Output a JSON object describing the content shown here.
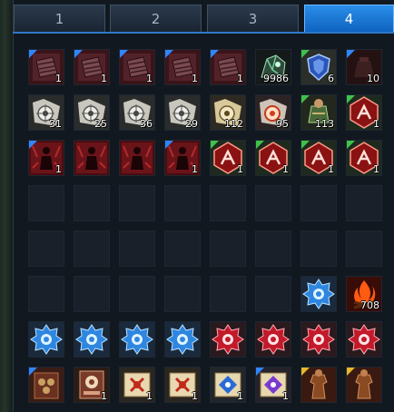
{
  "tabs": [
    {
      "label": "1",
      "active": false
    },
    {
      "label": "2",
      "active": false
    },
    {
      "label": "3",
      "active": false
    },
    {
      "label": "4",
      "active": true
    }
  ],
  "rows": [
    [
      {
        "icon": "dark-scroll-icon",
        "qty": "1",
        "tri": "#2f86ff"
      },
      {
        "icon": "dark-scroll-icon",
        "qty": "1",
        "tri": "#2f86ff"
      },
      {
        "icon": "dark-scroll-icon",
        "qty": "1",
        "tri": "#2f86ff"
      },
      {
        "icon": "dark-scroll-icon",
        "qty": "1",
        "tri": "#2f86ff"
      },
      {
        "icon": "dark-scroll-icon",
        "qty": "1",
        "tri": "#2f86ff"
      },
      {
        "icon": "green-ore-icon",
        "qty": "9986",
        "tri": ""
      },
      {
        "icon": "blue-shield-icon",
        "qty": "6",
        "tri": "#3fc24a"
      },
      {
        "icon": "dark-pouch-icon",
        "qty": "10",
        "tri": "#2f86ff"
      }
    ],
    [
      {
        "icon": "map-scroll-icon",
        "qty": "31",
        "tri": ""
      },
      {
        "icon": "map-scroll-icon",
        "qty": "25",
        "tri": ""
      },
      {
        "icon": "map-scroll-icon",
        "qty": "36",
        "tri": ""
      },
      {
        "icon": "map-scroll-icon",
        "qty": "29",
        "tri": ""
      },
      {
        "icon": "map-scroll-gold-icon",
        "qty": "112",
        "tri": ""
      },
      {
        "icon": "map-scroll-red-icon",
        "qty": "95",
        "tri": ""
      },
      {
        "icon": "adventurer-bag-icon",
        "qty": "113",
        "tri": "#3fc24a"
      },
      {
        "icon": "red-rune-icon",
        "qty": "1",
        "tri": "#3fc24a"
      }
    ],
    [
      {
        "icon": "red-figure-icon",
        "qty": "1",
        "tri": "#2f86ff"
      },
      {
        "icon": "red-figure-icon",
        "qty": "",
        "tri": ""
      },
      {
        "icon": "red-figure-icon",
        "qty": "",
        "tri": ""
      },
      {
        "icon": "red-figure-icon",
        "qty": "1",
        "tri": "#2f86ff"
      },
      {
        "icon": "red-rune-icon",
        "qty": "1",
        "tri": "#3fc24a"
      },
      {
        "icon": "red-rune-icon",
        "qty": "1",
        "tri": "#3fc24a"
      },
      {
        "icon": "red-rune-icon",
        "qty": "1",
        "tri": "#3fc24a"
      },
      {
        "icon": "red-rune-icon",
        "qty": "1",
        "tri": "#3fc24a"
      }
    ],
    [
      null,
      null,
      null,
      null,
      null,
      null,
      null,
      null
    ],
    [
      null,
      null,
      null,
      null,
      null,
      null,
      null,
      null
    ],
    [
      null,
      null,
      null,
      null,
      null,
      null,
      {
        "icon": "blue-gear-icon",
        "qty": "",
        "tri": ""
      },
      {
        "icon": "campfire-icon",
        "qty": "708",
        "tri": ""
      }
    ],
    [
      {
        "icon": "blue-gear-icon",
        "qty": "",
        "tri": ""
      },
      {
        "icon": "blue-gear-icon",
        "qty": "",
        "tri": ""
      },
      {
        "icon": "blue-gear-icon",
        "qty": "",
        "tri": ""
      },
      {
        "icon": "blue-gear-icon",
        "qty": "",
        "tri": ""
      },
      {
        "icon": "red-gear-icon",
        "qty": "",
        "tri": ""
      },
      {
        "icon": "red-gear-icon",
        "qty": "",
        "tri": ""
      },
      {
        "icon": "red-gear-icon",
        "qty": "",
        "tri": ""
      },
      {
        "icon": "red-gear-icon",
        "qty": "",
        "tri": ""
      }
    ],
    [
      {
        "icon": "brown-tome-icon",
        "qty": "",
        "tri": "#2f86ff"
      },
      {
        "icon": "card-book-icon",
        "qty": "1",
        "tri": ""
      },
      {
        "icon": "parchment-red-icon",
        "qty": "1",
        "tri": ""
      },
      {
        "icon": "parchment-red-icon",
        "qty": "1",
        "tri": ""
      },
      {
        "icon": "parchment-blue-icon",
        "qty": "1",
        "tri": ""
      },
      {
        "icon": "parchment-purple-icon",
        "qty": "1",
        "tri": "#2f86ff"
      },
      {
        "icon": "costume-icon",
        "qty": "",
        "tri": "#e6b82c"
      },
      {
        "icon": "costume-icon",
        "qty": "",
        "tri": "#e6b82c"
      }
    ]
  ]
}
